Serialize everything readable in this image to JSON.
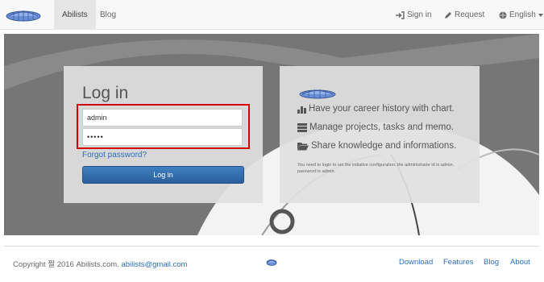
{
  "nav": {
    "tabs": [
      {
        "label": "Abilists",
        "active": true
      },
      {
        "label": "Blog",
        "active": false
      }
    ],
    "sign_in": "Sign in",
    "request": "Request",
    "language": "English"
  },
  "login": {
    "title": "Log in",
    "username_value": "admin",
    "password_value": "•••••",
    "forgot_password": "Forgot password?",
    "submit_label": "Log in"
  },
  "info": {
    "features": [
      "Have your career history with chart.",
      "Manage projects, tasks and memo.",
      "Share knowledge and informations."
    ],
    "note": "You need to login to set the initiative configuration. the administrator id is admin. password is admin."
  },
  "footer": {
    "copyright": "Copyright ",
    "copyright_symbol": "짤",
    "copyright_rest": " 2016 Abilists.com.",
    "email": "abilists@gmail.com",
    "links": [
      "Download",
      "Features",
      "Blog",
      "About"
    ]
  },
  "colors": {
    "accent": "#2a6ebb",
    "button": "#2a5f9a",
    "highlight": "#d40000",
    "hero_bg": "#767676"
  }
}
